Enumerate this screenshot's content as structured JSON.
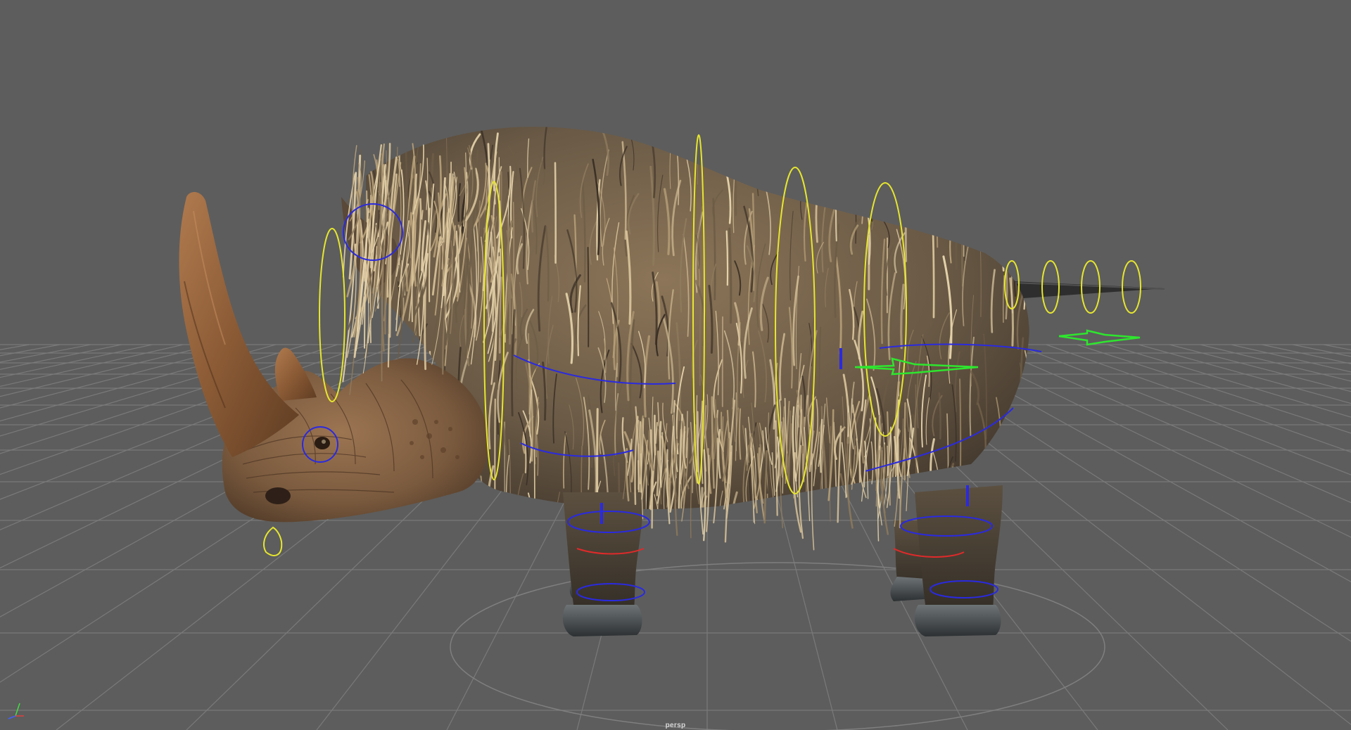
{
  "viewport": {
    "camera_label": "persp",
    "background_color": "#5d5d5d",
    "grid_color": "#7a7a7a",
    "model": "woolly-rhinoceros",
    "control_colors": {
      "spine": "#e6e62e",
      "joint": "#2a2ae0",
      "ik_foot": "#e02a2a",
      "root": "#2ee62e"
    },
    "axis_gizmo": {
      "x_color": "#e04040",
      "y_color": "#40e040",
      "z_color": "#4060ff"
    }
  }
}
